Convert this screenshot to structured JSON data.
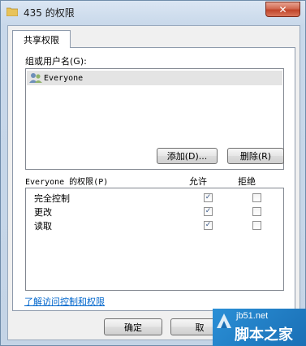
{
  "window": {
    "title": "435 的权限",
    "close_glyph": "✕"
  },
  "tab": {
    "label": "共享权限"
  },
  "group_label": "组或用户名(G):",
  "users": [
    {
      "name": "Everyone",
      "icon": "users-icon"
    }
  ],
  "buttons": {
    "add": "添加(D)...",
    "remove": "删除(R)",
    "ok": "确定",
    "cancel": "取"
  },
  "permissions": {
    "title": "Everyone 的权限(P)",
    "allow_header": "允许",
    "deny_header": "拒绝",
    "rows": [
      {
        "name": "完全控制",
        "allow": true,
        "deny": false
      },
      {
        "name": "更改",
        "allow": true,
        "deny": false
      },
      {
        "name": "读取",
        "allow": true,
        "deny": false
      }
    ]
  },
  "link": "了解访问控制和权限",
  "watermark": {
    "url": "jb51.net",
    "brand": "脚本之家"
  },
  "colors": {
    "link": "#0066cc",
    "watermark_bg": "#1a6fb5"
  }
}
